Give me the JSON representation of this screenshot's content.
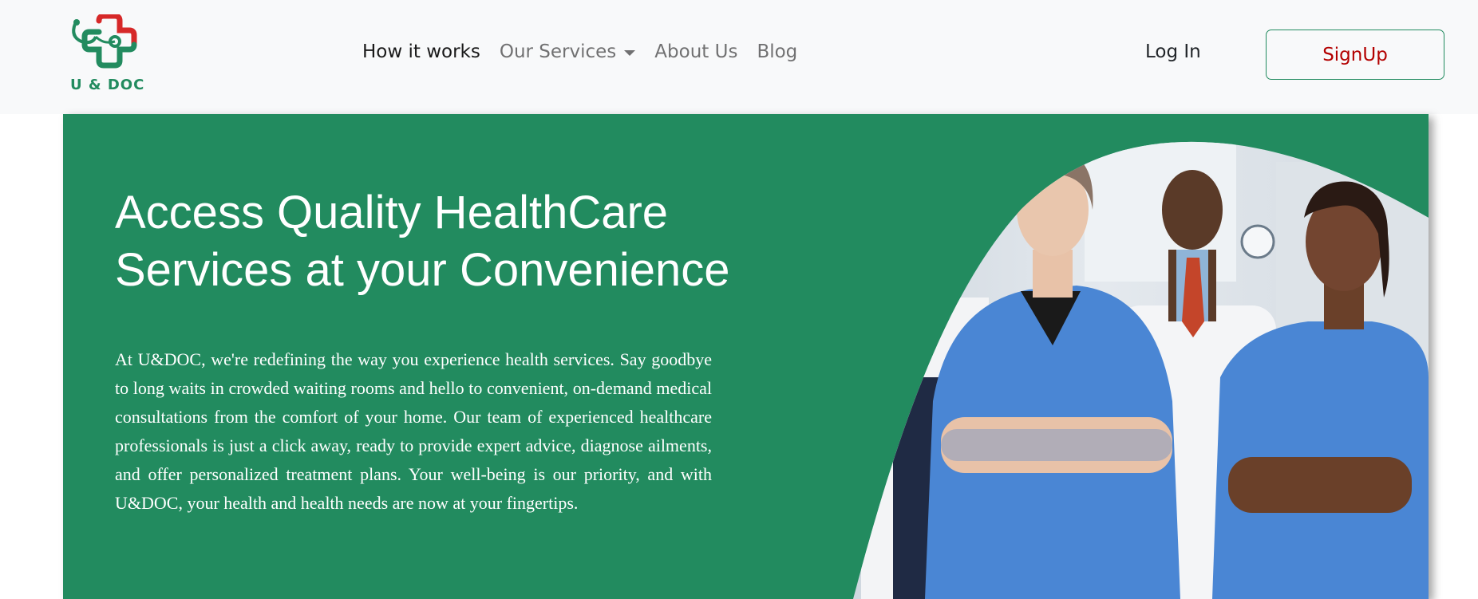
{
  "brand": {
    "logo_text": "U & DOC"
  },
  "nav": {
    "items": [
      {
        "label": "How it works",
        "active": true
      },
      {
        "label": "Our Services",
        "dropdown": true
      },
      {
        "label": "About Us"
      },
      {
        "label": "Blog"
      }
    ],
    "login_label": "Log In",
    "signup_label": "SignUp"
  },
  "hero": {
    "title_line1": "Access Quality HealthCare",
    "title_line2": "Services at your Convenience",
    "body": "At U&DOC, we're redefining the way you experience health services. Say goodbye to long waits in crowded waiting rooms and hello to convenient, on-demand medical consultations from the comfort of your home. Our team of experienced healthcare professionals is just a click away, ready to provide expert advice, diagnose ailments, and offer personalized treatment plans. Your well-being is our priority, and with U&DOC, your health and health needs are now at your fingertips."
  },
  "colors": {
    "brand_green": "#228b5f",
    "brand_red": "#d62828",
    "navbar_bg": "#f8f9fa",
    "scrub_blue": "#4a86d4"
  }
}
